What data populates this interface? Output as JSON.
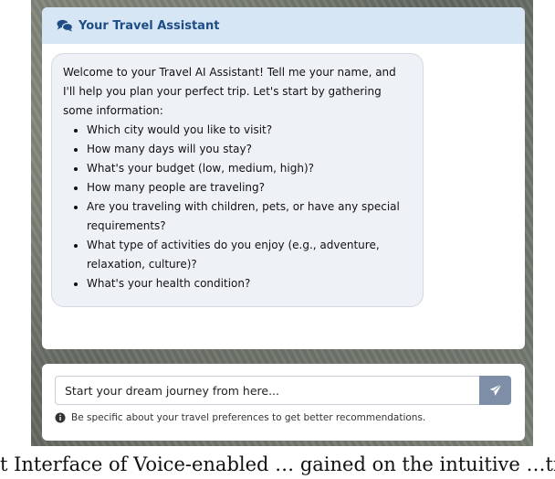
{
  "header": {
    "title": "Your Travel Assistant",
    "icon": "comments-icon"
  },
  "message": {
    "intro": "Welcome to your Travel AI Assistant! Tell me your name, and I'll help you plan your perfect trip. Let's start by gathering some information:",
    "questions": [
      "Which city would you like to visit?",
      "How many days will you stay?",
      "What's your budget (low, medium, high)?",
      "How many people are traveling?",
      "Are you traveling with children, pets, or have any special requirements?",
      "What type of activities do you enjoy (e.g., adventure, relaxation, culture)?",
      "What's your health condition?"
    ]
  },
  "input": {
    "placeholder": "Start your dream journey from here...",
    "send_icon": "paper-plane-icon"
  },
  "hint": {
    "text": "Be specific about your travel preferences to get better recommendations.",
    "icon": "info-circle-icon"
  },
  "caption": "t Interface of Voice-enabled … gained on the intuitive …tives ai"
}
